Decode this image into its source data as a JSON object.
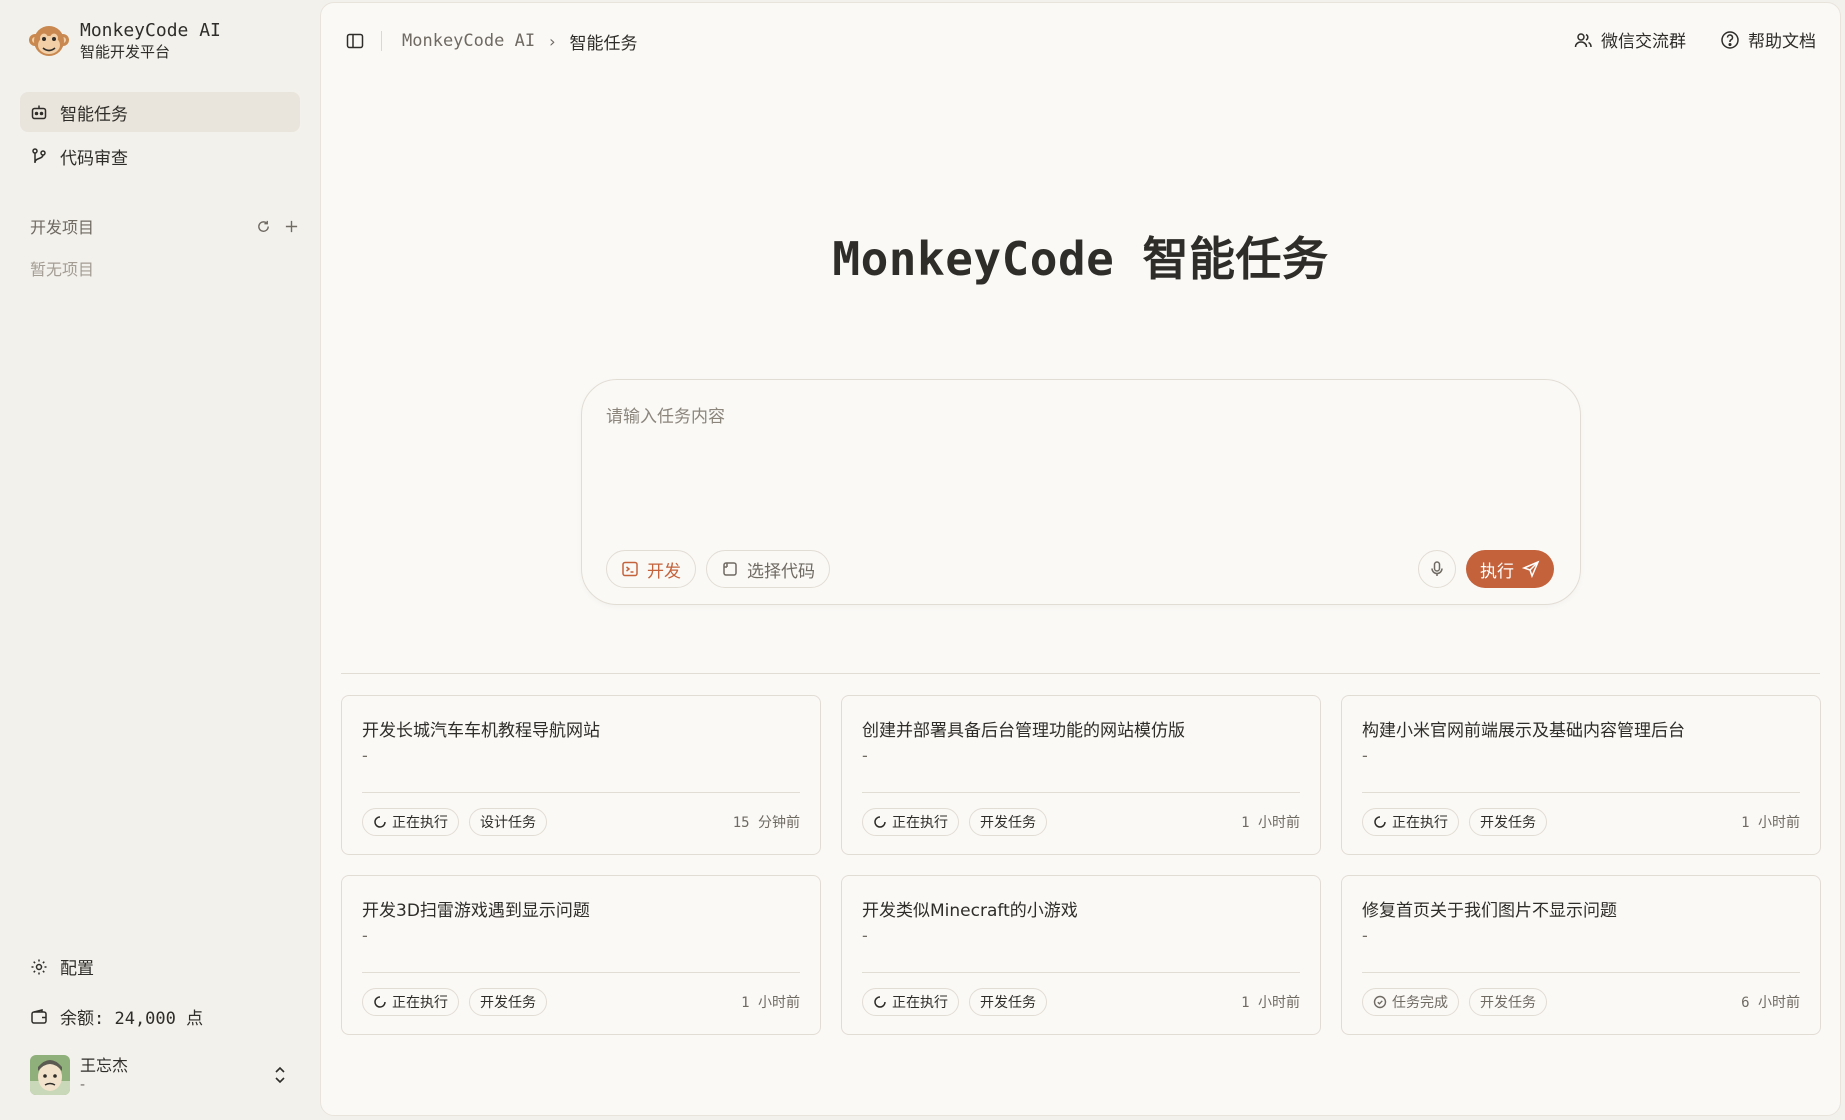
{
  "brand": {
    "name": "MonkeyCode AI",
    "subtitle": "智能开发平台"
  },
  "sidebar": {
    "nav": [
      {
        "label": "智能任务",
        "icon": "robot-icon",
        "active": true
      },
      {
        "label": "代码审查",
        "icon": "git-review-icon",
        "active": false
      }
    ],
    "projects": {
      "title": "开发项目",
      "empty": "暂无项目"
    },
    "settings_label": "配置",
    "balance_label": "余额: 24,000 点",
    "user": {
      "name": "王忘杰",
      "subtitle": "-"
    }
  },
  "breadcrumb": {
    "root": "MonkeyCode AI",
    "current": "智能任务"
  },
  "header_links": {
    "wechat": "微信交流群",
    "docs": "帮助文档"
  },
  "hero": {
    "title": "MonkeyCode 智能任务"
  },
  "composer": {
    "placeholder": "请输入任务内容",
    "mode_label": "开发",
    "select_code_label": "选择代码",
    "submit_label": "执行"
  },
  "tasks": [
    {
      "title": "开发长城汽车车机教程导航网站",
      "desc": "-",
      "status": "正在执行",
      "type": "设计任务",
      "time": "15 分钟前"
    },
    {
      "title": "创建并部署具备后台管理功能的网站模仿版",
      "desc": "-",
      "status": "正在执行",
      "type": "开发任务",
      "time": "1 小时前"
    },
    {
      "title": "构建小米官网前端展示及基础内容管理后台",
      "desc": "-",
      "status": "正在执行",
      "type": "开发任务",
      "time": "1 小时前"
    },
    {
      "title": "开发3D扫雷游戏遇到显示问题",
      "desc": "-",
      "status": "正在执行",
      "type": "开发任务",
      "time": "1 小时前"
    },
    {
      "title": "开发类似Minecraft的小游戏",
      "desc": "-",
      "status": "正在执行",
      "type": "开发任务",
      "time": "1 小时前"
    },
    {
      "title": "修复首页关于我们图片不显示问题",
      "desc": "-",
      "status": "任务完成",
      "type": "开发任务",
      "time": "6 小时前"
    }
  ],
  "colors": {
    "accent": "#c4623c",
    "background": "#f3f1ec",
    "panel": "#faf9f6"
  }
}
